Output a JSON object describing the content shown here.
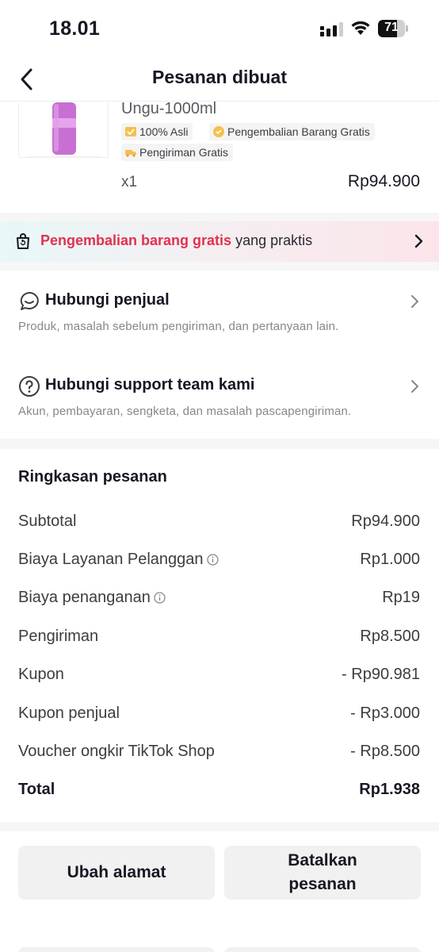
{
  "status_bar": {
    "time": "18.01",
    "battery": "71",
    "battery_level": 0.71
  },
  "header": {
    "title": "Pesanan dibuat",
    "back_icon": "chevron-left-icon"
  },
  "product": {
    "variant": "Ungu-1000ml",
    "tags": [
      {
        "label": "100% Asli",
        "icon": "authentic-badge-icon"
      },
      {
        "label": "Pengembalian Barang Gratis",
        "icon": "free-return-icon"
      },
      {
        "label": "Pengiriman Gratis",
        "icon": "free-shipping-icon"
      }
    ],
    "quantity": "x1",
    "price": "Rp94.900"
  },
  "return_banner": {
    "highlight": "Pengembalian barang gratis",
    "rest": " yang praktis",
    "icon": "shopping-bag-return-icon"
  },
  "contact": [
    {
      "title": "Hubungi penjual",
      "subtitle": "Produk, masalah sebelum pengiriman, dan pertanyaan lain.",
      "icon": "chat-bubble-icon"
    },
    {
      "title": "Hubungi support team kami",
      "subtitle": "Akun, pembayaran, sengketa, dan masalah pascapengiriman.",
      "icon": "question-circle-icon"
    }
  ],
  "summary": {
    "title": "Ringkasan pesanan",
    "rows": [
      {
        "label": "Subtotal",
        "value": "Rp94.900"
      },
      {
        "label": "Biaya Layanan Pelanggan",
        "value": "Rp1.000",
        "info": true
      },
      {
        "label": "Biaya penanganan",
        "value": "Rp19",
        "info": true
      },
      {
        "label": "Pengiriman",
        "value": "Rp8.500"
      },
      {
        "label": "Kupon",
        "value": "- Rp90.981"
      },
      {
        "label": "Kupon penjual",
        "value": "- Rp3.000"
      },
      {
        "label": "Voucher ongkir TikTok Shop",
        "value": "- Rp8.500"
      },
      {
        "label": "Total",
        "value": "Rp1.938"
      }
    ]
  },
  "actions": {
    "change_address": "Ubah alamat",
    "cancel_order_line1": "Batalkan",
    "cancel_order_line2": "pesanan"
  },
  "colors": {
    "accent_red": "#e0324f",
    "product_purple": "#c86fd3"
  }
}
